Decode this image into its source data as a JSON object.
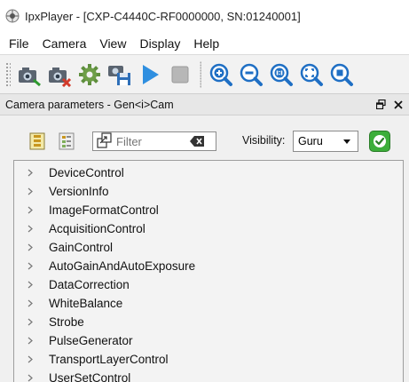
{
  "window": {
    "title": "IpxPlayer -  [CXP-C4440C-RF0000000, SN:01240001]"
  },
  "menu": {
    "items": [
      "File",
      "Camera",
      "View",
      "Display",
      "Help"
    ]
  },
  "toolbar": {
    "buttons": [
      "camera-connect-icon",
      "camera-disconnect-icon",
      "settings-gear-icon",
      "save-camera-config-icon",
      "play-icon",
      "stop-icon",
      "zoom-in-icon",
      "zoom-out-icon",
      "zoom-1to1-icon",
      "zoom-fit-icon",
      "zoom-window-icon"
    ]
  },
  "panel": {
    "title": "Camera parameters - Gen<i>Cam"
  },
  "filter": {
    "placeholder": "Filter",
    "value": ""
  },
  "visibility": {
    "label": "Visibility:",
    "selected": "Guru"
  },
  "colors": {
    "accent_green": "#3cae3a",
    "play_blue": "#2f8fe0"
  },
  "tree": {
    "items": [
      "DeviceControl",
      "VersionInfo",
      "ImageFormatControl",
      "AcquisitionControl",
      "GainControl",
      "AutoGainAndAutoExposure",
      "DataCorrection",
      "WhiteBalance",
      "Strobe",
      "PulseGenerator",
      "TransportLayerControl",
      "UserSetControl"
    ]
  }
}
